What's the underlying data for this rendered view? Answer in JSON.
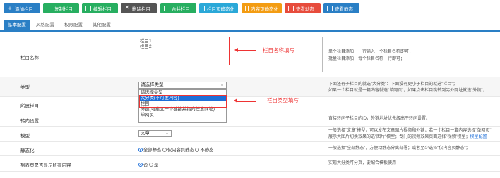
{
  "toolbar": {
    "buttons": [
      {
        "label": "添加栏目",
        "icon": "plus-icon",
        "color": "#2a7fc5"
      },
      {
        "label": "复制栏目",
        "icon": "copy-icon",
        "color": "#27ae60"
      },
      {
        "label": "编辑栏目",
        "icon": "edit-icon",
        "color": "#27ae60"
      },
      {
        "label": "删除栏目",
        "icon": "close-icon",
        "color": "#555555"
      },
      {
        "label": "合并栏目",
        "icon": "merge-icon",
        "color": "#27ae60"
      },
      {
        "label": "栏目页静态化",
        "icon": "file-icon",
        "color": "#2aa8d8"
      },
      {
        "label": "内容页静态化",
        "icon": "file-icon",
        "color": "#f39c12"
      },
      {
        "label": "查看动态",
        "icon": "eye-icon",
        "color": "#e74c3c"
      },
      {
        "label": "查看静态",
        "icon": "eye-icon",
        "color": "#2a7fc5"
      }
    ]
  },
  "tabs": [
    "基本配置",
    "风格配置",
    "权限配置",
    "其他配置"
  ],
  "form": {
    "name": {
      "label": "栏目名称",
      "lines": [
        "栏目1",
        "栏目2"
      ],
      "help1": "单个栏目添加：一行输入一个栏目名称即可；",
      "help2": "批量栏目添加：每个栏目名称一行即可；",
      "annotation": "栏目名称填写"
    },
    "type": {
      "label": "类型",
      "value": "请选择类型",
      "options": [
        "请选择类型",
        "大分类(不可发内容)",
        "栏目",
        "外链(可建立一个链接并指向任意网址)",
        "单网页"
      ],
      "selected_index": 1,
      "help1": "下面还有子栏目的就选\"大分类\"：下面没有更小子栏目的就选\"栏目\"；",
      "help2": "如果一个栏目就是一篇内容就选\"单网页\"；如果点击栏目跳转到另外网址就选\"外链\"；",
      "annotation": "栏目类型填写"
    },
    "parent": {
      "label": "所属栏目"
    },
    "redirect": {
      "label": "转向设置",
      "help": "直接转向子栏目的ID，外链地址优先级高于转向设置。"
    },
    "model": {
      "label": "模型",
      "value": "文章",
      "help1": "一般选择\"文章\"模型，可以发布文章图片视频和外链；若一个栏目一篇内容选择\"单网页\"",
      "help2": "展示大图片切换效果的选\"图片\"模型；专门的视频效果页面选择\"视频\"模型；",
      "help2_link": "模型配置"
    },
    "static": {
      "label": "静态化",
      "options": [
        "全部静态",
        "仅内容页静态",
        "不静态"
      ],
      "help": "一般选择\"全部静态\"，方便动静态分离部署；或者至少选择\"仅内容页静态\"；"
    },
    "list": {
      "label": "列表页是否显示所有内容",
      "options": [
        "否",
        "是"
      ],
      "help": "实现大分类可分页，要配合模板使用"
    }
  }
}
